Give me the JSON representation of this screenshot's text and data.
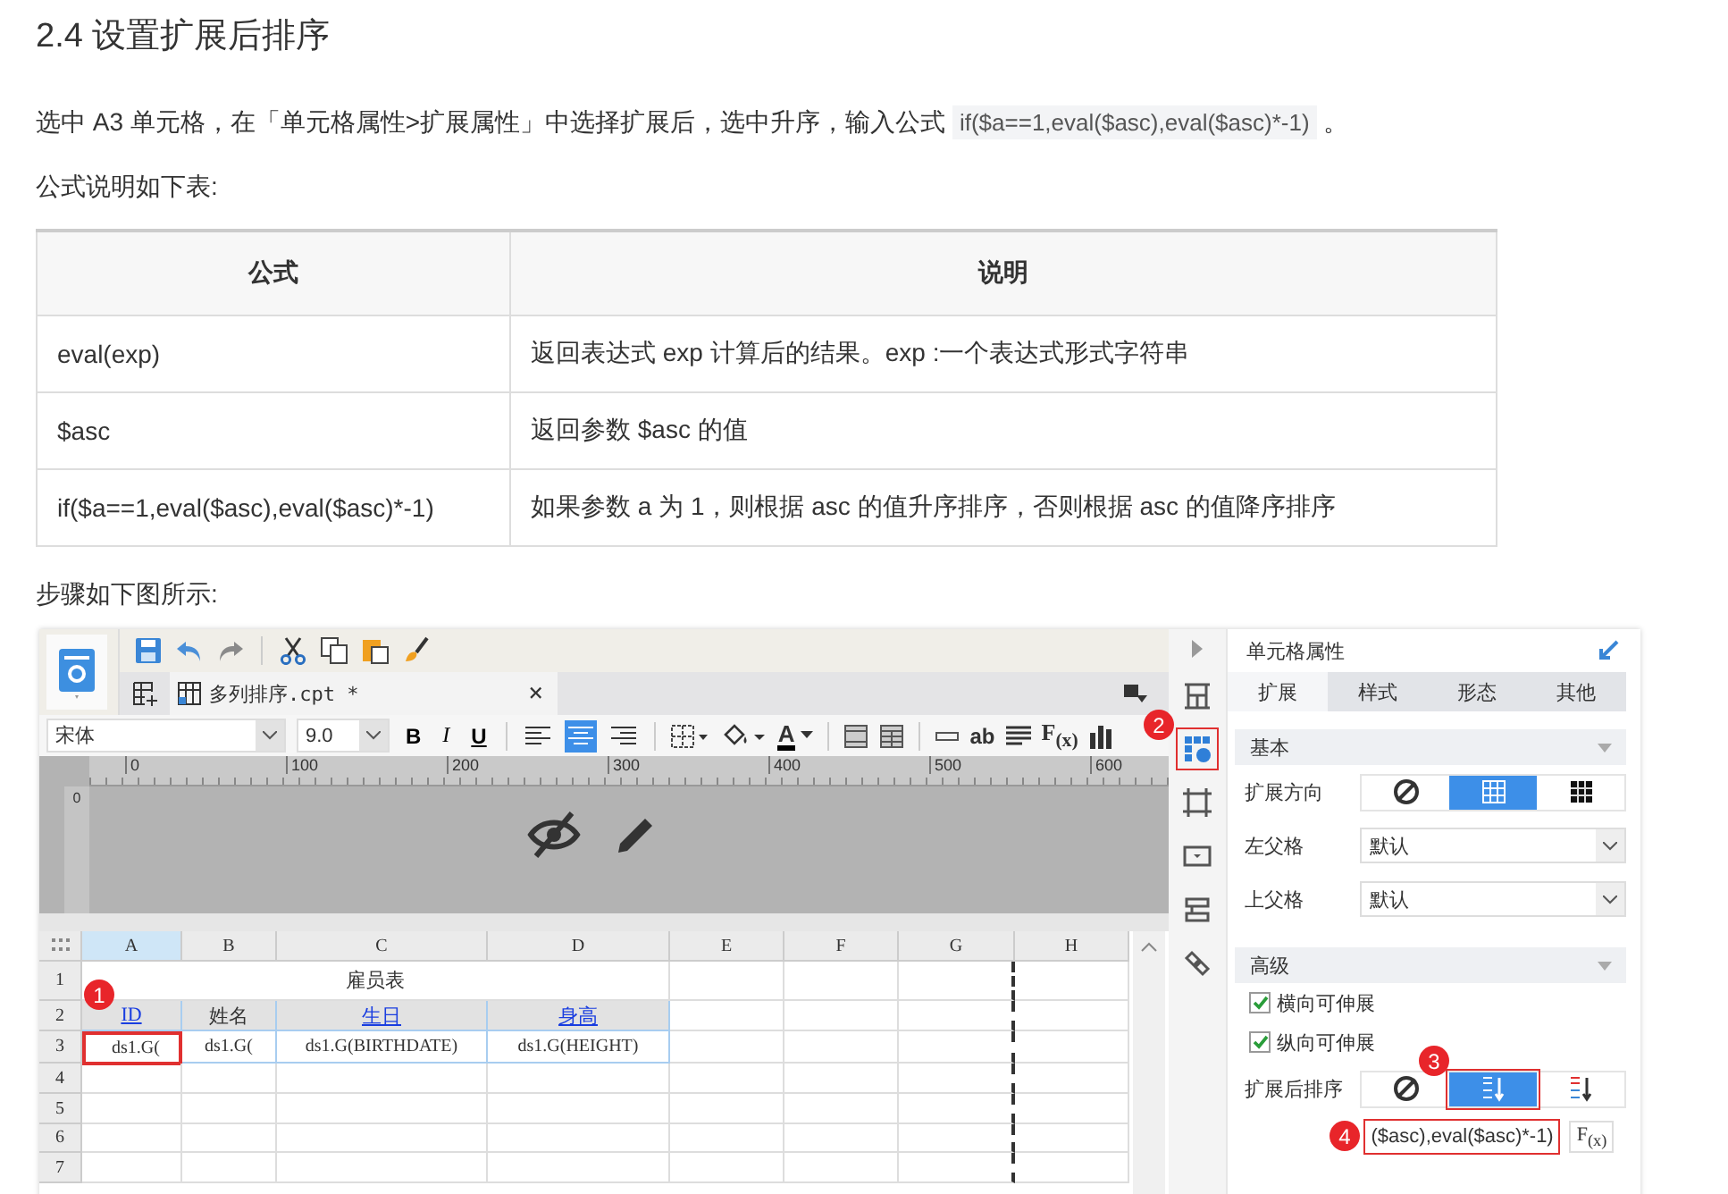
{
  "heading": "2.4 设置扩展后排序",
  "intro": {
    "text": "选中 A3 单元格，在「单元格属性>扩展属性」中选择扩展后，选中升序，输入公式",
    "code": "if($a==1,eval($asc),eval($asc)*-1)",
    "end": "。"
  },
  "table_caption": "公式说明如下表:",
  "table": {
    "columns": [
      "公式",
      "说明"
    ],
    "rows": [
      [
        "eval(exp)",
        "返回表达式 exp 计算后的结果。exp :一个表达式形式字符串"
      ],
      [
        "$asc",
        "返回参数 $asc 的值"
      ],
      [
        "if($a==1,eval($asc),eval($asc)*-1)",
        "如果参数 a 为 1，则根据 asc 的值升序排序，否则根据 asc 的值降序排序"
      ]
    ]
  },
  "steps_caption": "步骤如下图所示:",
  "screenshot": {
    "file_tab": {
      "title": "多列排序.cpt *",
      "close": "×"
    },
    "font_select": "宋体",
    "size_select": "9.0",
    "style_buttons": [
      {
        "label": "B",
        "kind": "bold"
      },
      {
        "label": "I",
        "kind": "italic"
      },
      {
        "label": "U",
        "kind": "underline"
      }
    ],
    "align_buttons": [
      {
        "kind": "left",
        "selected": false
      },
      {
        "kind": "center",
        "selected": true
      },
      {
        "kind": "right",
        "selected": false
      }
    ],
    "font_color_label": "A",
    "text_tool_label": "ab",
    "formula_label": "F$_{(x)}$",
    "ruler": [
      "0",
      "100",
      "200",
      "300",
      "400",
      "500",
      "600"
    ],
    "ruler_side": "0",
    "grid": {
      "columns": [
        {
          "label": "A",
          "selected": true
        },
        {
          "label": "B",
          "selected": false
        },
        {
          "label": "C",
          "selected": false
        },
        {
          "label": "D",
          "selected": false
        },
        {
          "label": "E",
          "selected": false
        },
        {
          "label": "F",
          "selected": false
        },
        {
          "label": "G",
          "selected": false
        },
        {
          "label": "H",
          "selected": false
        }
      ],
      "rows": [
        "1",
        "2",
        "3",
        "4",
        "5",
        "6",
        "7"
      ],
      "title": "雇员表",
      "headers": [
        {
          "text": "ID",
          "link": true
        },
        {
          "text": "姓名",
          "link": false
        },
        {
          "text": "生日",
          "link": true
        },
        {
          "text": "身高",
          "link": true
        }
      ],
      "cells": [
        {
          "text": "ds1.G(",
          "selected": true
        },
        {
          "text": "ds1.G(",
          "selected": false
        },
        {
          "text": "ds1.G(BIRTHDATE)",
          "selected": false
        },
        {
          "text": "ds1.G(HEIGHT)",
          "selected": false
        }
      ]
    },
    "side_icons": [
      {
        "kind": "layout",
        "selected": false
      },
      {
        "kind": "cell",
        "selected": true
      },
      {
        "kind": "frame",
        "selected": false
      },
      {
        "kind": "widget",
        "selected": false
      },
      {
        "kind": "stack",
        "selected": false
      },
      {
        "kind": "link",
        "selected": false
      }
    ],
    "panel": {
      "title": "单元格属性",
      "tabs": [
        {
          "label": "扩展",
          "selected": true
        },
        {
          "label": "样式",
          "selected": false
        },
        {
          "label": "形态",
          "selected": false
        },
        {
          "label": "其他",
          "selected": false
        }
      ],
      "basic": {
        "title": "基本",
        "direction": {
          "label": "扩展方向",
          "options": [
            {
              "kind": "none",
              "selected": false
            },
            {
              "kind": "vertical",
              "selected": true
            },
            {
              "kind": "horizontal",
              "selected": false
            }
          ]
        },
        "left_parent": {
          "label": "左父格",
          "value": "默认"
        },
        "top_parent": {
          "label": "上父格",
          "value": "默认"
        }
      },
      "advanced": {
        "title": "高级",
        "checks": [
          {
            "label": "横向可伸展",
            "checked": true
          },
          {
            "label": "纵向可伸展",
            "checked": true
          }
        ],
        "sort": {
          "label": "扩展后排序",
          "options": [
            {
              "kind": "none",
              "selected": false
            },
            {
              "kind": "ascending",
              "selected": true
            },
            {
              "kind": "descending",
              "selected": false
            }
          ]
        },
        "formula": {
          "value": "($asc),eval($asc)*-1)",
          "button": "F$_{(x)}$"
        }
      }
    },
    "badges": [
      "1",
      "2",
      "3",
      "4"
    ]
  }
}
